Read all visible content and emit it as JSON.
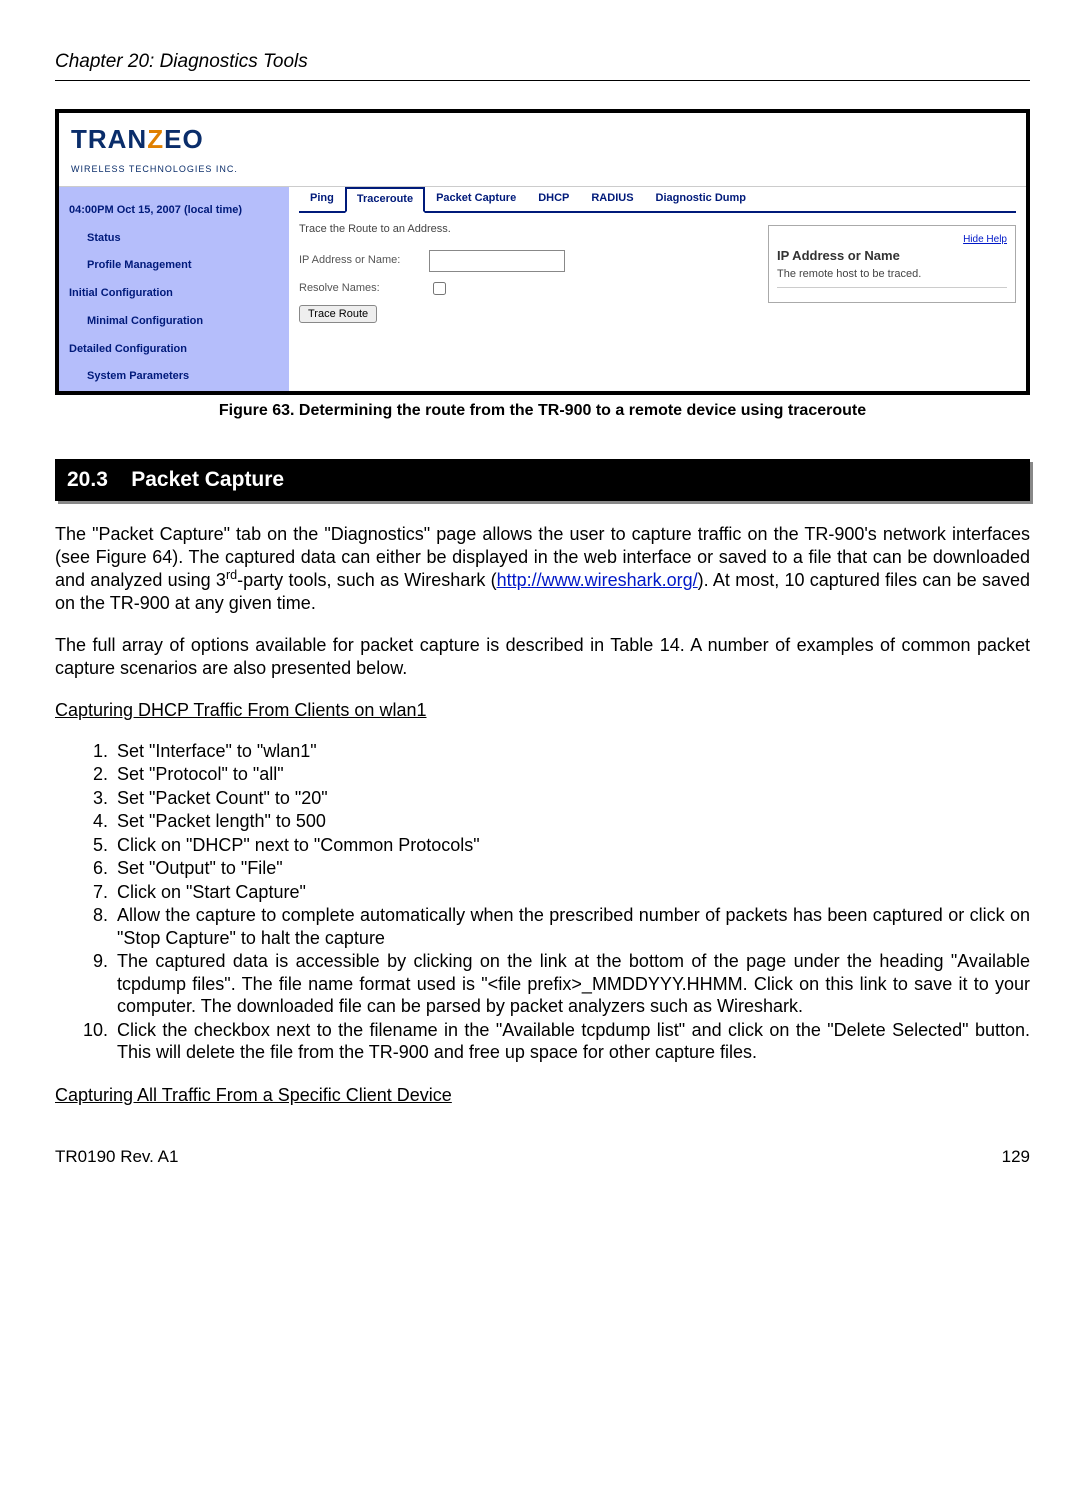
{
  "header": {
    "chapter": "Chapter 20: Diagnostics Tools"
  },
  "screenshot": {
    "logo_main": "TRANZEO",
    "logo_sub": "WIRELESS TECHNOLOGIES INC.",
    "sidebar": {
      "clock": "04:00PM Oct 15, 2007 (local time)",
      "status": "Status",
      "profile": "Profile Management",
      "initial": "Initial Configuration",
      "minimal": "Minimal Configuration",
      "detailed": "Detailed Configuration",
      "sysparam": "System Parameters"
    },
    "tabs": {
      "ping": "Ping",
      "trace": "Traceroute",
      "pcap": "Packet Capture",
      "dhcp": "DHCP",
      "radius": "RADIUS",
      "dump": "Diagnostic Dump"
    },
    "desc": "Trace the Route to an Address.",
    "lbl_ip": "IP Address or Name:",
    "lbl_resolve": "Resolve Names:",
    "btn": "Trace Route",
    "help": {
      "hide": "Hide Help",
      "title": "IP Address or Name",
      "text": "The remote host to be traced."
    }
  },
  "caption": "Figure 63. Determining the route from the TR-900 to a remote device using traceroute",
  "section": {
    "number": "20.3",
    "title": "Packet Capture"
  },
  "para1a": "The \"Packet Capture\" tab on the \"Diagnostics\" page allows the user to capture traffic on the TR-900's network interfaces (see Figure 64). The captured data can either be displayed in the web interface or saved to a file that can be downloaded and analyzed using 3",
  "para1b": "-party tools, such as Wireshark (",
  "para1link": "http://www.wireshark.org/",
  "para1c": "). At most, 10 captured files can be saved on the TR-900 at any given time.",
  "para2": "The full array of options available for packet capture is described in Table 14. A number of examples of common packet capture scenarios are also presented below.",
  "sub1": "Capturing DHCP Traffic From Clients on wlan1",
  "steps": [
    "Set \"Interface\" to \"wlan1\"",
    "Set \"Protocol\" to \"all\"",
    "Set \"Packet Count\" to \"20\"",
    "Set \"Packet length\" to 500",
    "Click on \"DHCP\" next to \"Common Protocols\"",
    "Set \"Output\" to \"File\"",
    "Click on \"Start Capture\"",
    "Allow the capture to complete automatically when the prescribed number of packets has been captured or click on \"Stop Capture\" to halt the capture",
    "The captured data is accessible by clicking on the link at the bottom of the page under the heading \"Available tcpdump files\". The file name format used is \"<file prefix>_MMDDYYY.HHMM. Click on this link to save it to your computer. The downloaded file can be parsed by packet analyzers such as Wireshark.",
    "Click the checkbox next to the filename in the \"Available tcpdump list\" and click on the \"Delete Selected\" button. This will delete the file from the TR-900 and free up space for other capture files."
  ],
  "sub2": "Capturing All Traffic From a Specific Client Device",
  "footer": {
    "left": "TR0190 Rev. A1",
    "right": "129"
  }
}
